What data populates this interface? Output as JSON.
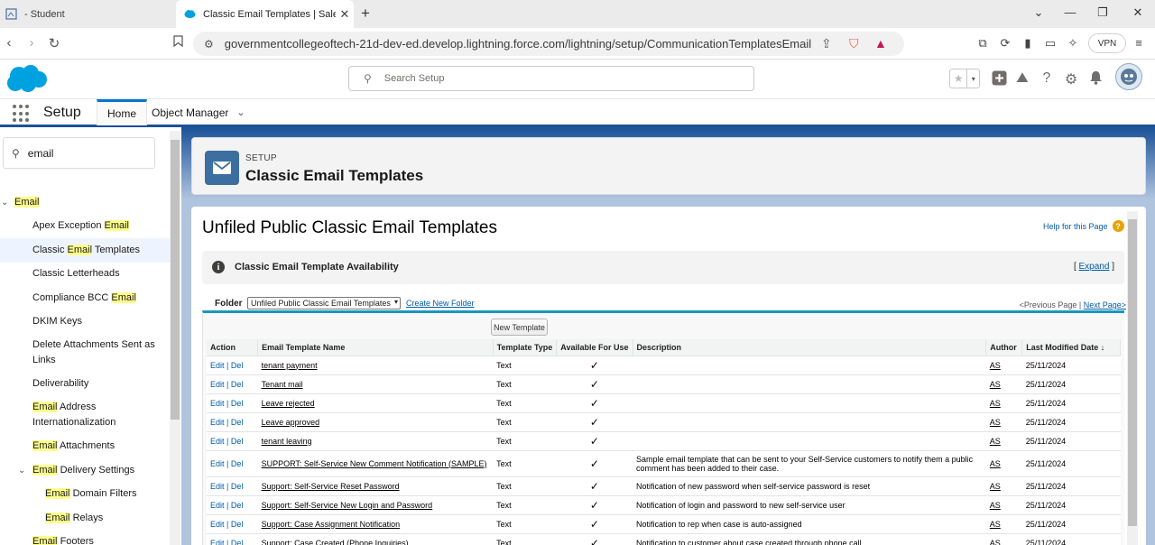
{
  "browser": {
    "tabs": [
      {
        "title": "- Student"
      },
      {
        "title": "Classic Email Templates | Salesf"
      }
    ],
    "url": "governmentcollegeoftech-21d-dev-ed.develop.lightning.force.com/lightning/setup/CommunicationTemplatesEmail/page?a...",
    "vpn_label": "VPN"
  },
  "header": {
    "search_placeholder": "Search Setup"
  },
  "context": {
    "app_name": "Setup",
    "tabs": [
      {
        "label": "Home"
      },
      {
        "label": "Object Manager"
      }
    ]
  },
  "sidebar": {
    "quickfind_value": "email",
    "items": [
      {
        "pre": "",
        "hl": "Email",
        "post": ""
      },
      {
        "pre": "Apex Exception ",
        "hl": "Email",
        "post": ""
      },
      {
        "pre": "Classic ",
        "hl": "Email",
        "post": " Templates"
      },
      {
        "pre": "Classic Letterheads",
        "hl": "",
        "post": ""
      },
      {
        "pre": "Compliance BCC ",
        "hl": "Email",
        "post": ""
      },
      {
        "pre": "DKIM Keys",
        "hl": "",
        "post": ""
      },
      {
        "pre": "Delete Attachments Sent as Links",
        "hl": "",
        "post": ""
      },
      {
        "pre": "Deliverability",
        "hl": "",
        "post": ""
      },
      {
        "pre": "",
        "hl": "Email",
        "post": " Address Internationalization"
      },
      {
        "pre": "",
        "hl": "Email",
        "post": " Attachments"
      },
      {
        "pre": "",
        "hl": "Email",
        "post": " Delivery Settings"
      },
      {
        "pre": "",
        "hl": "Email",
        "post": " Domain Filters"
      },
      {
        "pre": "",
        "hl": "Email",
        "post": " Relays"
      },
      {
        "pre": "",
        "hl": "Email",
        "post": " Footers"
      }
    ]
  },
  "page": {
    "breadcrumb": "SETUP",
    "title": "Classic Email Templates",
    "section_title": "Unfiled Public Classic Email Templates",
    "help_link": "Help for this Page",
    "availability_title": "Classic Email Template Availability",
    "expand_label": "Expand",
    "folder_label": "Folder",
    "folder_value": "Unfiled Public Classic Email Templates",
    "create_folder": "Create New Folder",
    "prev_page": "<Previous Page",
    "next_page": "Next Page>",
    "new_template_button": "New Template"
  },
  "table": {
    "columns": [
      "Action",
      "Email Template Name",
      "Template Type",
      "Available For Use",
      "Description",
      "Author",
      "Last Modified Date"
    ],
    "sort_indicator": "↓",
    "rows": [
      {
        "action": "Edit | Del",
        "name": "tenant payment",
        "type": "Text",
        "available": "✓",
        "description": "",
        "author": "AS",
        "modified": "25/11/2024"
      },
      {
        "action": "Edit | Del",
        "name": "Tenant mail",
        "type": "Text",
        "available": "✓",
        "description": "",
        "author": "AS",
        "modified": "25/11/2024"
      },
      {
        "action": "Edit | Del",
        "name": "Leave rejected",
        "type": "Text",
        "available": "✓",
        "description": "",
        "author": "AS",
        "modified": "25/11/2024"
      },
      {
        "action": "Edit | Del",
        "name": "Leave approved",
        "type": "Text",
        "available": "✓",
        "description": "",
        "author": "AS",
        "modified": "25/11/2024"
      },
      {
        "action": "Edit | Del",
        "name": "tenant leaving",
        "type": "Text",
        "available": "✓",
        "description": "",
        "author": "AS",
        "modified": "25/11/2024"
      },
      {
        "action": "Edit | Del",
        "name": "SUPPORT: Self-Service New Comment Notification (SAMPLE)",
        "type": "Text",
        "available": "✓",
        "description": "Sample email template that can be sent to your Self-Service customers to notify them a public comment has been added to their case.",
        "author": "AS",
        "modified": "25/11/2024"
      },
      {
        "action": "Edit | Del",
        "name": "Support: Self-Service Reset Password",
        "type": "Text",
        "available": "✓",
        "description": "Notification of new password when self-service password is reset",
        "author": "AS",
        "modified": "25/11/2024"
      },
      {
        "action": "Edit | Del",
        "name": "Support: Self-Service New Login and Password",
        "type": "Text",
        "available": "✓",
        "description": "Notification of login and password to new self-service user",
        "author": "AS",
        "modified": "25/11/2024"
      },
      {
        "action": "Edit | Del",
        "name": "Support: Case Assignment Notification",
        "type": "Text",
        "available": "✓",
        "description": "Notification to rep when case is auto-assigned",
        "author": "AS",
        "modified": "25/11/2024"
      },
      {
        "action": "Edit | Del",
        "name": "Support: Case Created (Phone Inquiries)",
        "type": "Text",
        "available": "✓",
        "description": "Notification to customer about case created through phone call",
        "author": "AS",
        "modified": "25/11/2024"
      }
    ]
  },
  "colors": {
    "brand_blue": "#1b5297",
    "accent": "#0176d3",
    "link": "#015ba7",
    "highlight": "#ffff8c",
    "salesforce_cloud": "#00a1e0"
  }
}
